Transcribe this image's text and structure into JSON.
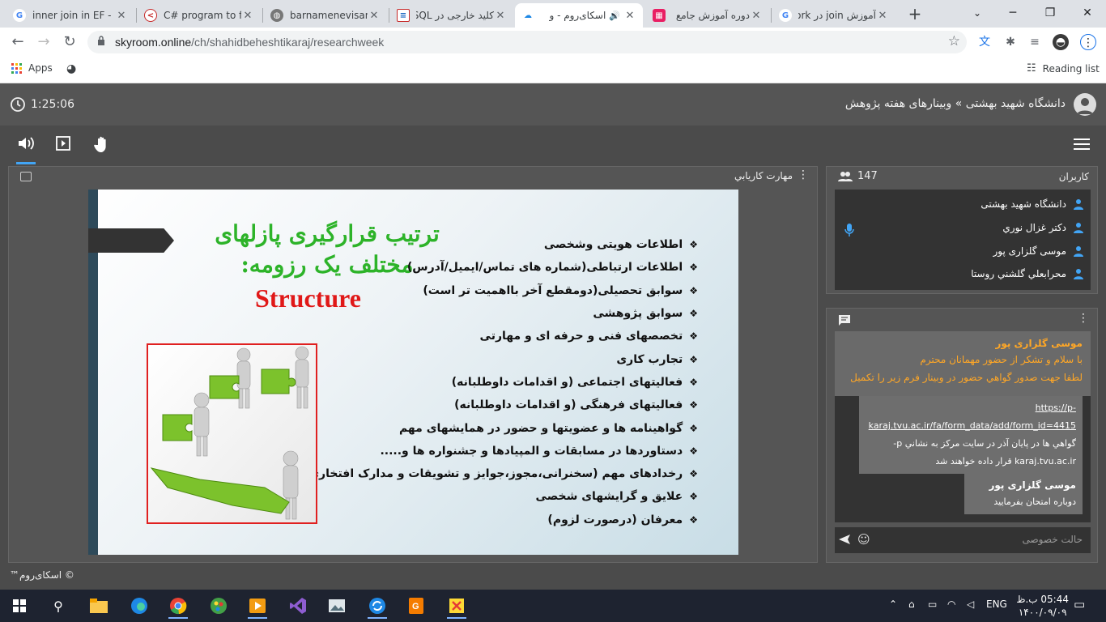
{
  "browser": {
    "tabs": [
      {
        "title": "inner join in EF - ",
        "favicon": "google-icon"
      },
      {
        "title": "C# program to fin",
        "favicon": "code-icon"
      },
      {
        "title": "barnamenevisan.",
        "favicon": "globe-icon"
      },
      {
        "title": "کلید خارجی در SQL",
        "favicon": "sql-icon"
      },
      {
        "title": "اسکای‌روم - و",
        "favicon": "skyroom-icon"
      },
      {
        "title": "دوره آموزش جامع",
        "favicon": "course-icon"
      },
      {
        "title": "آموزش join در ork",
        "favicon": "google-icon"
      }
    ],
    "url_host": "skyroom.online",
    "url_path": "/ch/shahidbeheshtikaraj/researchweek",
    "bookmarks": {
      "apps": "Apps",
      "reading_list": "Reading list"
    }
  },
  "app": {
    "timer": "1:25:06",
    "breadcrumb": "دانشگاه شهید بهشتی » وبینارهای هفته پژوهش",
    "stage_label": "مهارت كاريابي",
    "footer": "© اسکای‌روم™"
  },
  "slide": {
    "title": "ترتیب قرارگیری پازلهای مختلف یک رزومه:",
    "structure": "Structure",
    "bullets": [
      "اطلاعات هویتی وشخصی",
      "اطلاعات ارتباطی(شماره های تماس/ایمیل/آدرس)",
      "سوابق تحصیلی(دومقطع آخر بااهمیت تر است)",
      "سوابق پژوهشی",
      "تخصصهای فنی و حرفه ای و مهارتی",
      "تجارب کاری",
      "فعالیتهای اجتماعی (و اقدامات داوطلبانه)",
      "فعالیتهای فرهنگی (و اقدامات داوطلبانه)",
      "گواهینامه ها و عضویتها و حضور در همایشهای مهم",
      "دستاوردها در مسابقات و المپیادها و جشنواره ها و.....",
      "رخدادهای مهم (سخنرانی،مجوز،جوایز و تشویقات و مدارک افتخاری)",
      "علایق و گرایشهای شخصی",
      "معرفان (درصورت لزوم)"
    ]
  },
  "users_panel": {
    "title": "کاربران",
    "count": "147",
    "users": [
      "دانشگاه شهید بهشتی",
      "دكتر غزال نوري",
      "موسی گلزاری پور",
      "محرابعلي گلشني روستا"
    ]
  },
  "chat": {
    "notice_name": "موسی گلزاری پور",
    "notice_lines": [
      "با سلام و تشکر از حضور مهمانان محترم",
      "لطفا جهت صدور گواهي حضور در وبينار فرم زير را تكميل"
    ],
    "msg1_link1": "https://p-",
    "msg1_link2": "karaj.tvu.ac.ir/fa/form_data/add/form_id=4415",
    "msg1_line3": "گواهي ها در پايان آذر در سايت مركز به نشاني p-",
    "msg1_line4": "karaj.tvu.ac.ir قرار داده خواهند شد",
    "msg2_name": "موسی گلزاری پور",
    "msg2_text": "دوباره امتحان بفرمایید",
    "input_placeholder": "حالت خصوصی"
  },
  "taskbar": {
    "lang": "ENG",
    "time": "05:44 ب.ظ",
    "date": "۱۴۰۰/۰۹/۰۹"
  },
  "colors": {
    "accent": "#42a5f5",
    "slide_title": "#2db329",
    "structure": "#e01818",
    "notice": "#ffa726"
  }
}
